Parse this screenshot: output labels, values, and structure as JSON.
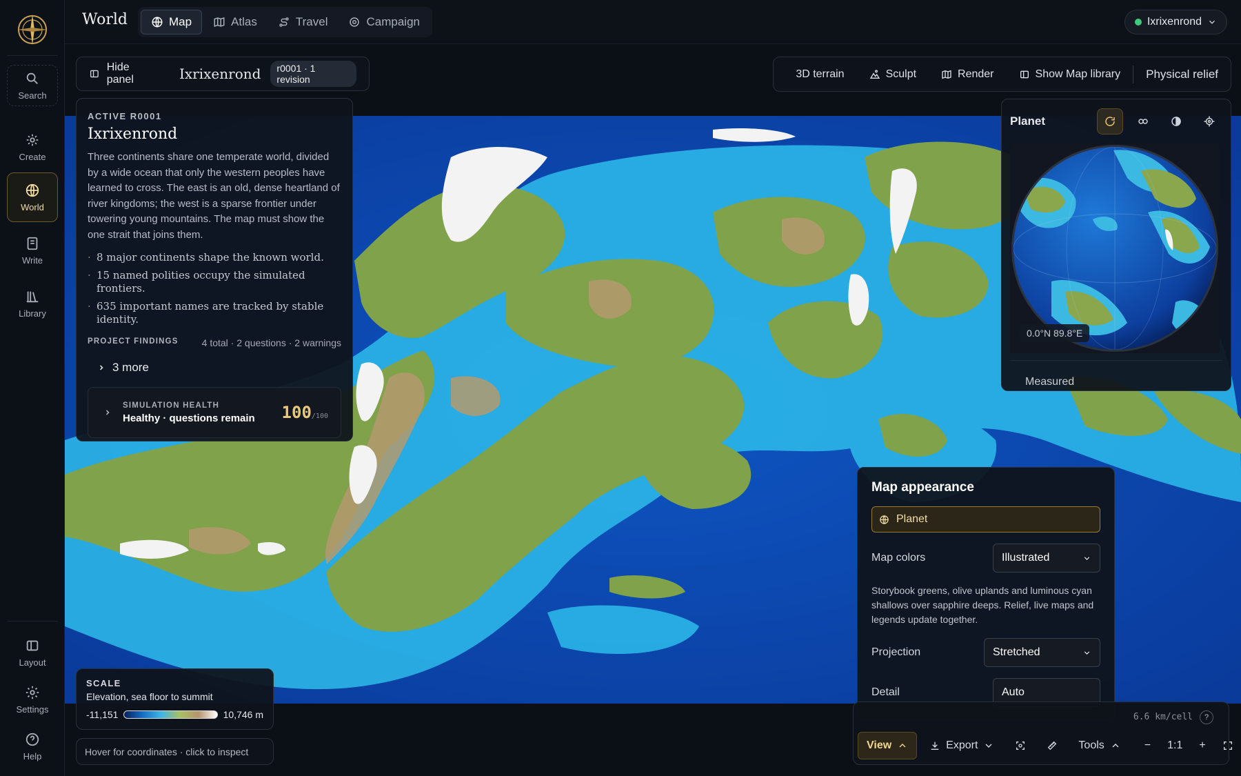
{
  "app": {
    "section_title": "World"
  },
  "nav": {
    "items": [
      {
        "label": "Search",
        "icon": "search-icon"
      },
      {
        "label": "Create",
        "icon": "sparkle-icon"
      },
      {
        "label": "World",
        "icon": "globe-icon"
      },
      {
        "label": "Write",
        "icon": "book-icon"
      },
      {
        "label": "Library",
        "icon": "library-icon"
      },
      {
        "label": "Layout",
        "icon": "layout-icon"
      },
      {
        "label": "Settings",
        "icon": "gear-icon"
      },
      {
        "label": "Help",
        "icon": "help-icon"
      }
    ]
  },
  "tabs": [
    {
      "label": "Map"
    },
    {
      "label": "Atlas"
    },
    {
      "label": "Travel"
    },
    {
      "label": "Campaign"
    }
  ],
  "user": {
    "name": "Ixrixenrond",
    "status_color": "#3ccb7f"
  },
  "panel_bar": {
    "hide_label": "Hide panel",
    "world_name": "Ixrixenrond",
    "revision": "r0001 · 1 revision"
  },
  "map_toolbar": {
    "terrain": "3D terrain",
    "sculpt": "Sculpt",
    "render": "Render",
    "library": "Show Map library",
    "relief": "Physical relief"
  },
  "info": {
    "eyebrow": "ACTIVE R0001",
    "title": "Ixrixenrond",
    "description": "Three continents share one temperate world, divided by a wide ocean that only the western peoples have learned to cross. The east is an old, dense heartland of river kingdoms; the west is a sparse frontier under towering young mountains. The map must show the one strait that joins them.",
    "bullets": [
      "8 major continents shape the known world.",
      "15 named polities occupy the simulated frontiers.",
      "635 important names are tracked by stable identity."
    ],
    "findings_label": "PROJECT FINDINGS",
    "findings_summary": "4 total · 2 questions · 2 warnings",
    "more": "3 more",
    "health_label": "SIMULATION HEALTH",
    "health_status": "Healthy · questions remain",
    "health_score": "100",
    "health_max": "/100"
  },
  "planet": {
    "title": "Planet",
    "coords": "0.0°N 89.8°E",
    "measured": "Measured"
  },
  "appearance": {
    "title": "Map appearance",
    "mode": "Planet",
    "colors_label": "Map colors",
    "colors_value": "Illustrated",
    "description": "Storybook greens, olive uplands and luminous cyan shallows over sapphire deeps. Relief, live maps and legends update together.",
    "projection_label": "Projection",
    "projection_value": "Stretched",
    "detail_label": "Detail",
    "detail_value": "Auto"
  },
  "bottom": {
    "km": "6.6 km/cell",
    "help": "?",
    "view": "View",
    "export": "Export",
    "tools": "Tools",
    "zoom_out": "−",
    "zoom_level": "1:1",
    "zoom_in": "+"
  },
  "scale": {
    "title": "SCALE",
    "subtitle": "Elevation, sea floor to summit",
    "min": "-11,151",
    "max": "10,746 m"
  },
  "hover_hint": "Hover for coordinates · click to inspect",
  "colors": {
    "accent": "#e8c97a",
    "ocean_deep": "#0d3f9e",
    "ocean_shallow": "#2fb9e8",
    "land": "#7fa24a",
    "upland": "#b49a6e",
    "snow": "#f4f4f4"
  }
}
